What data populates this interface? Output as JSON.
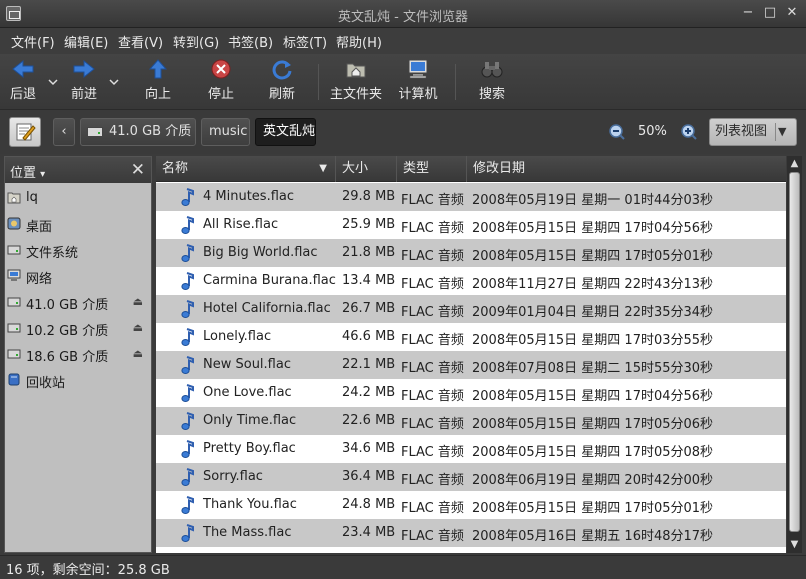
{
  "window": {
    "title": "英文乱炖 - 文件浏览器",
    "minimize": "−",
    "maximize": "□",
    "close": "✕"
  },
  "menu": [
    "文件(F)",
    "编辑(E)",
    "查看(V)",
    "转到(G)",
    "书签(B)",
    "标签(T)",
    "帮助(H)"
  ],
  "toolbar": {
    "back": "后退",
    "forward": "前进",
    "up": "向上",
    "stop": "停止",
    "reload": "刷新",
    "home": "主文件夹",
    "computer": "计算机",
    "search": "搜索"
  },
  "location": {
    "back_crumb": "‹",
    "crumbs": [
      "41.0 GB 介质",
      "music",
      "英文乱炖"
    ],
    "zoom": "50%",
    "view_mode": "列表视图"
  },
  "sidebar": {
    "title": "位置",
    "items": [
      {
        "label": "lq",
        "icon": "home-folder-icon"
      },
      {
        "label": "桌面",
        "icon": "desktop-icon"
      },
      {
        "label": "文件系统",
        "icon": "filesystem-icon"
      },
      {
        "label": "网络",
        "icon": "network-icon"
      },
      {
        "label": "41.0 GB 介质",
        "icon": "drive-icon",
        "eject": true
      },
      {
        "label": "10.2 GB 介质",
        "icon": "drive-icon",
        "eject": true
      },
      {
        "label": "18.6 GB 介质",
        "icon": "drive-icon",
        "eject": true
      },
      {
        "label": "回收站",
        "icon": "trash-icon"
      }
    ]
  },
  "columns": {
    "name": "名称",
    "size": "大小",
    "type": "类型",
    "date": "修改日期"
  },
  "files": [
    {
      "name": "4 Minutes.flac",
      "size": "29.8 MB",
      "type": "FLAC 音频",
      "date": "2008年05月19日 星期一 01时44分03秒"
    },
    {
      "name": "All Rise.flac",
      "size": "25.9 MB",
      "type": "FLAC 音频",
      "date": "2008年05月15日 星期四 17时04分56秒"
    },
    {
      "name": "Big Big World.flac",
      "size": "21.8 MB",
      "type": "FLAC 音频",
      "date": "2008年05月15日 星期四 17时05分01秒"
    },
    {
      "name": "Carmina Burana.flac",
      "size": "13.4 MB",
      "type": "FLAC 音频",
      "date": "2008年11月27日 星期四 22时43分13秒"
    },
    {
      "name": "Hotel California.flac",
      "size": "26.7 MB",
      "type": "FLAC 音频",
      "date": "2009年01月04日 星期日 22时35分34秒"
    },
    {
      "name": "Lonely.flac",
      "size": "46.6 MB",
      "type": "FLAC 音频",
      "date": "2008年05月15日 星期四 17时03分55秒"
    },
    {
      "name": "New Soul.flac",
      "size": "22.1 MB",
      "type": "FLAC 音频",
      "date": "2008年07月08日 星期二 15时55分30秒"
    },
    {
      "name": "One Love.flac",
      "size": "24.2 MB",
      "type": "FLAC 音频",
      "date": "2008年05月15日 星期四 17时04分56秒"
    },
    {
      "name": "Only Time.flac",
      "size": "22.6 MB",
      "type": "FLAC 音频",
      "date": "2008年05月15日 星期四 17时05分06秒"
    },
    {
      "name": "Pretty Boy.flac",
      "size": "34.6 MB",
      "type": "FLAC 音频",
      "date": "2008年05月15日 星期四 17时05分08秒"
    },
    {
      "name": "Sorry.flac",
      "size": "36.4 MB",
      "type": "FLAC 音频",
      "date": "2008年06月19日 星期四 20时42分00秒"
    },
    {
      "name": "Thank You.flac",
      "size": "24.8 MB",
      "type": "FLAC 音频",
      "date": "2008年05月15日 星期四 17时05分01秒"
    },
    {
      "name": "The Mass.flac",
      "size": "23.4 MB",
      "type": "FLAC 音频",
      "date": "2008年05月16日 星期五 16时48分17秒"
    }
  ],
  "status": "16 项，剩余空间：25.8 GB",
  "colors": {
    "row_odd": "#c8c8c8",
    "row_even": "#ffffff",
    "accent_blue": "#3a7bd5"
  }
}
